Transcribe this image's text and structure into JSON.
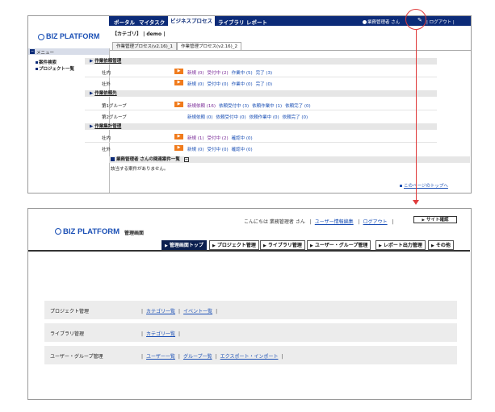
{
  "top": {
    "nav": [
      "ポータル",
      "マイタスク",
      "ビジネスプロセス",
      "ライブラリ",
      "レポート"
    ],
    "user": "業務管理者 さん",
    "logout": "ログアウト",
    "logo": "BIZ PLATFORM",
    "breadcrumb": "【カテゴリ】 | demo |",
    "menu_header": "メニュー",
    "menu_items": [
      "案件検索",
      "プロジェクト一覧"
    ],
    "tabs": [
      "作業管理プロセス(v2.16)_1",
      "作業管理プロセス(v2.16)_2"
    ],
    "sections": [
      {
        "title": "作業依頼管理",
        "rows": [
          {
            "label": "社内",
            "links": [
              "新規 (0)",
              "受付中 (2)",
              "作業中 (5)",
              "完了 (3)"
            ]
          },
          {
            "label": "社外",
            "links": [
              "新規 (0)",
              "受付中 (0)",
              "作業中 (0)",
              "完了 (0)"
            ]
          }
        ]
      },
      {
        "title": "作業依頼先",
        "rows": [
          {
            "label": "第1グループ",
            "links": [
              "新規依頼 (16)",
              "依頼受付中 (3)",
              "依頼作業中 (1)",
              "依頼完了 (0)"
            ]
          },
          {
            "label": "第2グループ",
            "links": [
              "新規依頼 (0)",
              "依頼受付中 (0)",
              "依頼作業中 (0)",
              "依頼完了 (0)"
            ]
          }
        ]
      },
      {
        "title": "作業集計管理",
        "rows": [
          {
            "label": "社内",
            "links": [
              "新規 (1)",
              "受付中 (2)",
              "確認中 (0)"
            ]
          },
          {
            "label": "社外",
            "links": [
              "新規 (0)",
              "受付中 (0)",
              "確認中 (0)"
            ]
          }
        ]
      }
    ],
    "related_title": "業務管理者 さんの関連案件一覧",
    "related_empty": "該当する案件がありません。",
    "page_top": "このページのトップへ"
  },
  "bottom": {
    "greeting": "こんにちは 業務管理者 さん",
    "user_edit": "ユーザー情報編集",
    "logout": "ログアウト",
    "site_check": "サイト確認",
    "logo": "BIZ PLATFORM",
    "subtitle": "管理画面",
    "tabs": [
      "管理画面トップ",
      "プロジェクト管理",
      "ライブラリ管理",
      "ユーザー・グループ管理",
      "レポート出力管理",
      "その他"
    ],
    "panels": [
      {
        "label": "プロジェクト管理",
        "links": [
          "カテゴリ一覧",
          "イベント一覧"
        ]
      },
      {
        "label": "ライブラリ管理",
        "links": [
          "カテゴリ一覧"
        ]
      },
      {
        "label": "ユーザー・グループ管理",
        "links": [
          "ユーザー一覧",
          "グループ一覧",
          "エクスポート・インポート"
        ]
      }
    ]
  },
  "colors": {
    "navy": "#0c2b78",
    "accent": "#e03b3b",
    "orange": "#f07b1c"
  }
}
